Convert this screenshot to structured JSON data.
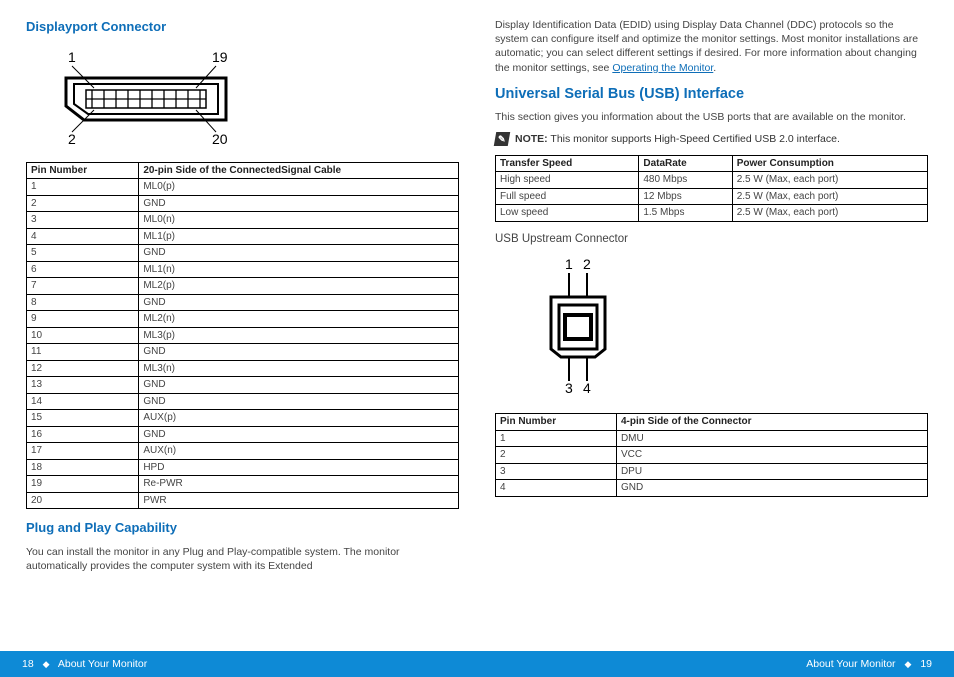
{
  "left": {
    "title_dp": "Displayport Connector",
    "dp_diagram": {
      "labels": [
        "1",
        "19",
        "2",
        "20"
      ]
    },
    "pin_table": {
      "headers": [
        "Pin Number",
        "20-pin Side of the ConnectedSignal Cable"
      ],
      "rows": [
        [
          "1",
          "ML0(p)"
        ],
        [
          "2",
          "GND"
        ],
        [
          "3",
          "ML0(n)"
        ],
        [
          "4",
          "ML1(p)"
        ],
        [
          "5",
          "GND"
        ],
        [
          "6",
          "ML1(n)"
        ],
        [
          "7",
          "ML2(p)"
        ],
        [
          "8",
          "GND"
        ],
        [
          "9",
          "ML2(n)"
        ],
        [
          "10",
          "ML3(p)"
        ],
        [
          "11",
          "GND"
        ],
        [
          "12",
          "ML3(n)"
        ],
        [
          "13",
          "GND"
        ],
        [
          "14",
          "GND"
        ],
        [
          "15",
          "AUX(p)"
        ],
        [
          "16",
          "GND"
        ],
        [
          "17",
          "AUX(n)"
        ],
        [
          "18",
          "HPD"
        ],
        [
          "19",
          "Re-PWR"
        ],
        [
          "20",
          "PWR"
        ]
      ]
    },
    "title_pnp": "Plug and Play Capability",
    "pnp_text": "You can install the monitor in any Plug and Play-compatible system. The monitor automatically provides the computer system with its Extended"
  },
  "right": {
    "edid_text_a": "Display Identification Data (EDID) using Display Data Channel (DDC) protocols so the system can configure itself and optimize the monitor settings. Most monitor installations are automatic; you can select different settings if desired. For more information about changing the monitor settings, see ",
    "edid_link": "Operating the Monitor",
    "edid_text_b": ".",
    "title_usb": "Universal Serial Bus (USB) Interface",
    "usb_intro": "This section gives you information about the USB ports that are available on the monitor.",
    "note_label": "NOTE:",
    "note_text": " This monitor supports High-Speed Certified USB 2.0 interface.",
    "speed_table": {
      "headers": [
        "Transfer Speed",
        "DataRate",
        "Power Consumption"
      ],
      "rows": [
        [
          "High speed",
          "480 Mbps",
          "2.5 W (Max, each port)"
        ],
        [
          "Full speed",
          "12 Mbps",
          "2.5 W (Max, each port)"
        ],
        [
          "Low speed",
          "1.5 Mbps",
          "2.5 W (Max, each port)"
        ]
      ]
    },
    "upstream_label": "USB Upstream Connector",
    "usb_diagram": {
      "labels": [
        "1",
        "2",
        "3",
        "4"
      ]
    },
    "conn_table": {
      "headers": [
        "Pin Number",
        "4-pin Side of the Connector"
      ],
      "rows": [
        [
          "1",
          "DMU"
        ],
        [
          "2",
          "VCC"
        ],
        [
          "3",
          "DPU"
        ],
        [
          "4",
          "GND"
        ]
      ]
    }
  },
  "footer": {
    "left_page": "18",
    "left_text": "About Your Monitor",
    "right_text": "About Your Monitor",
    "right_page": "19",
    "diamond": "◆"
  }
}
